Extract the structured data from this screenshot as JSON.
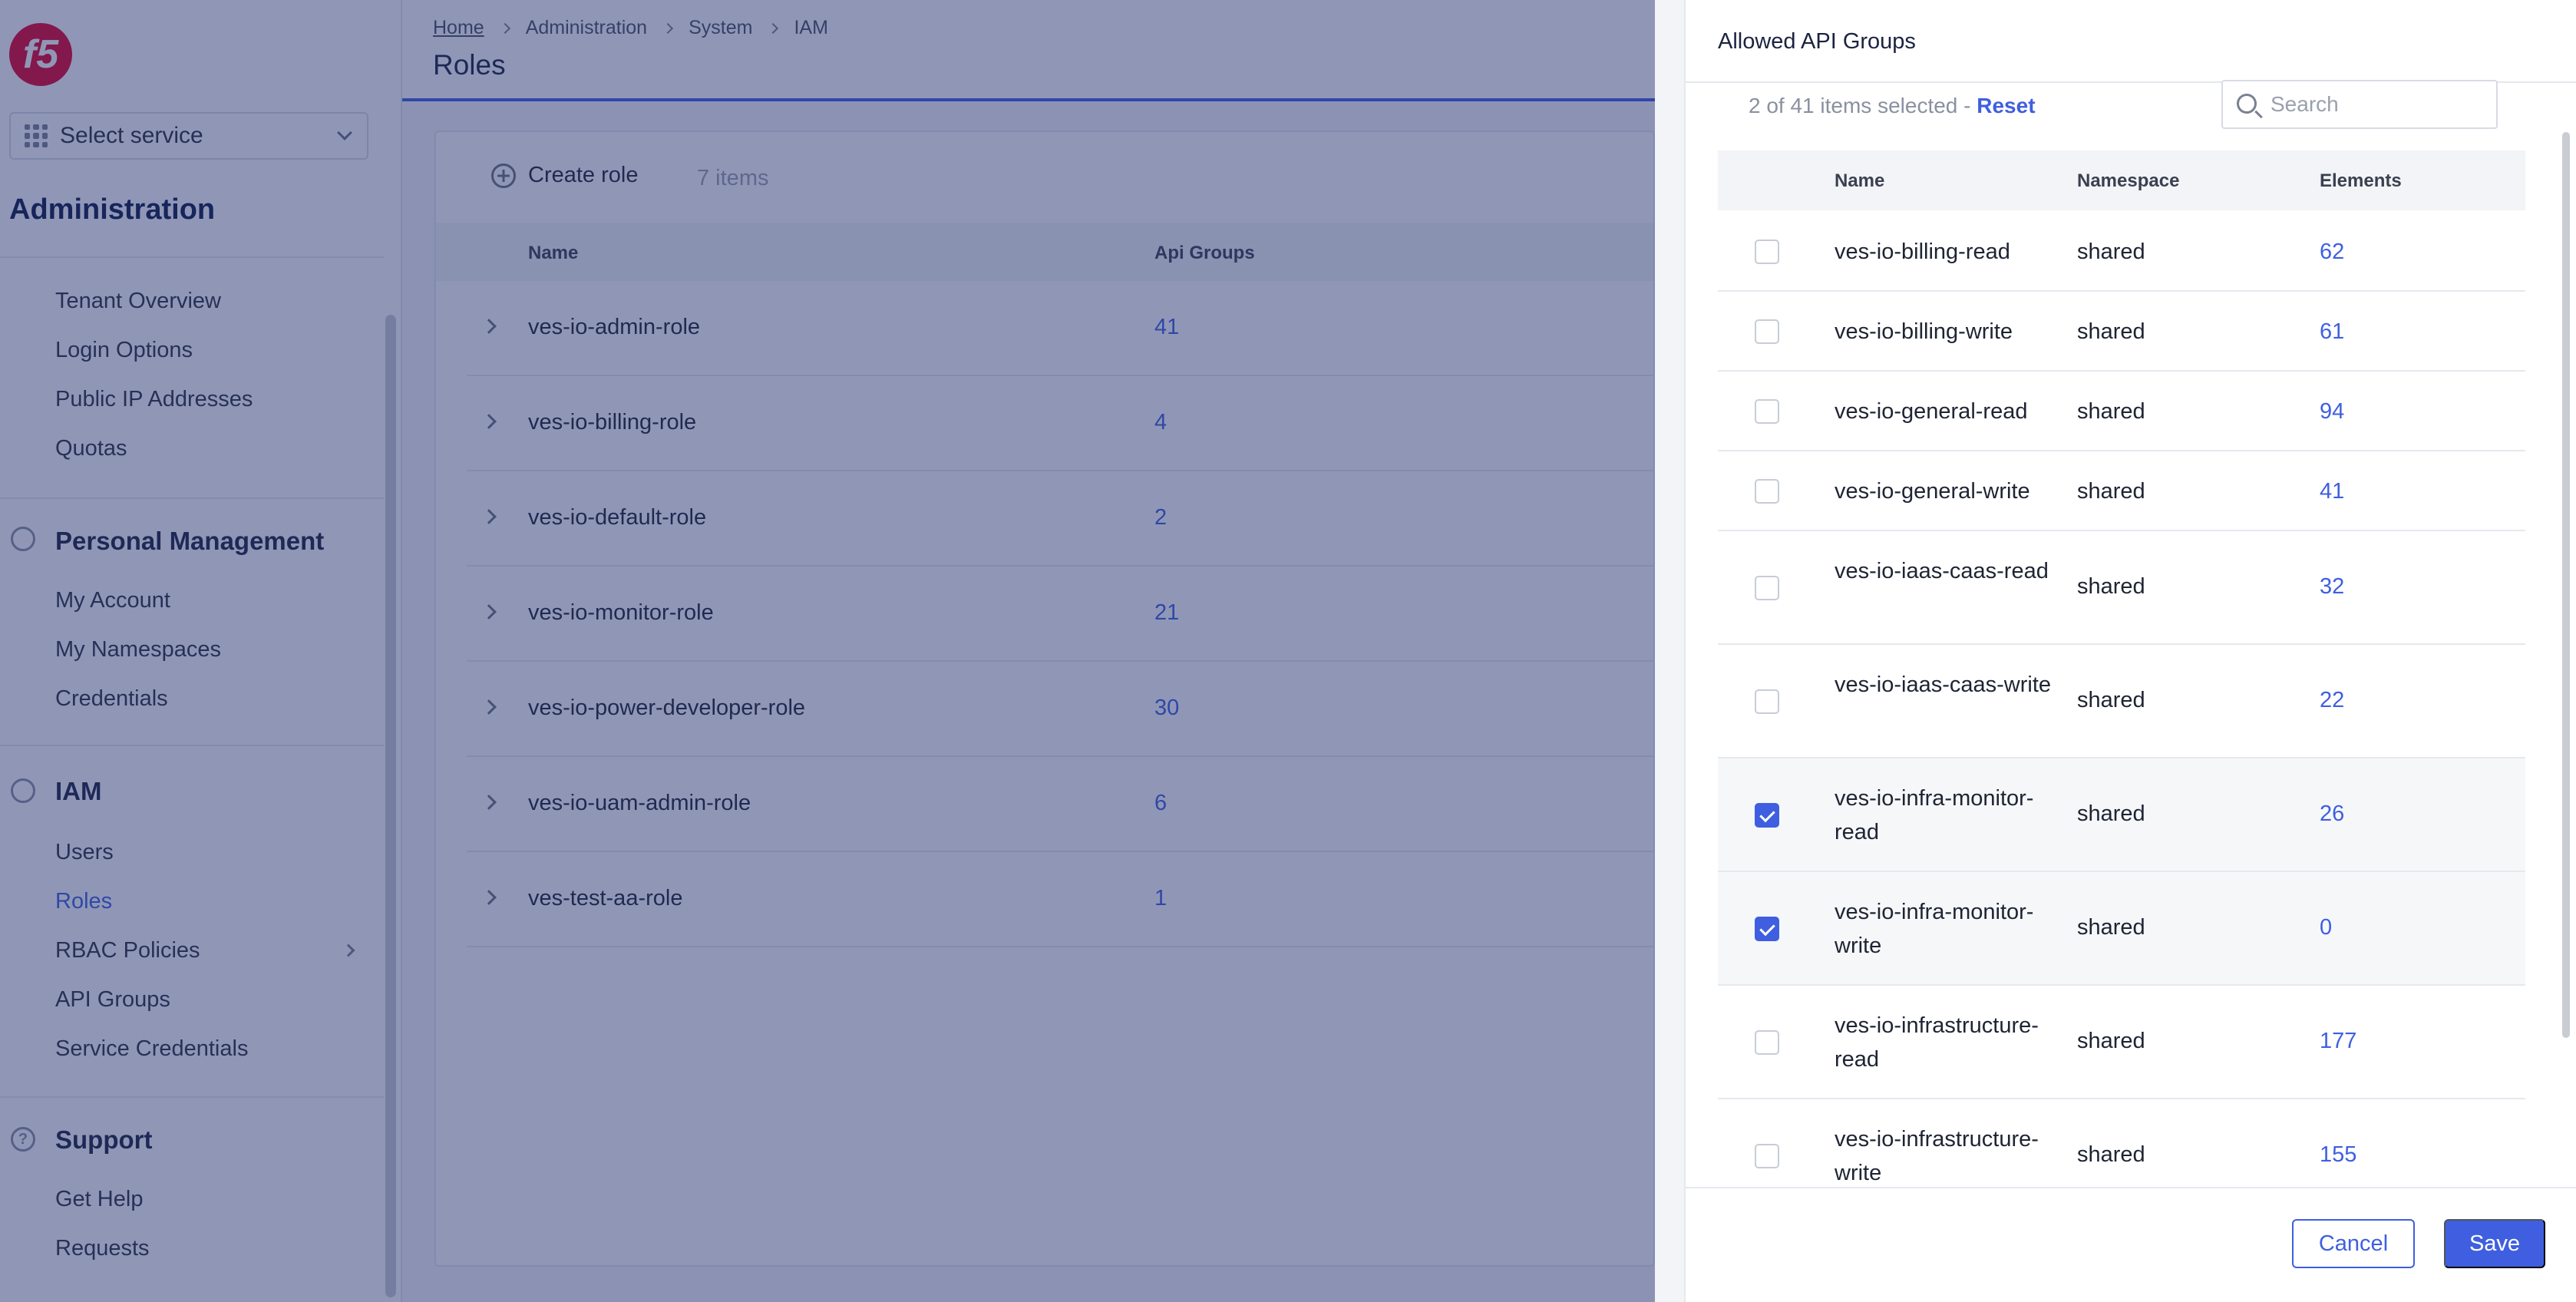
{
  "logo_text": "f5",
  "sidebar": {
    "service_select": "Select service",
    "heading": "Administration",
    "admin_items": [
      "Tenant Overview",
      "Login Options",
      "Public IP Addresses",
      "Quotas"
    ],
    "personal": {
      "title": "Personal Management",
      "items": [
        "My Account",
        "My Namespaces",
        "Credentials"
      ]
    },
    "iam": {
      "title": "IAM",
      "items": [
        "Users",
        "Roles",
        "RBAC Policies",
        "API Groups",
        "Service Credentials"
      ],
      "active": "Roles"
    },
    "support": {
      "title": "Support",
      "icon_glyph": "?",
      "items": [
        "Get Help",
        "Requests"
      ]
    }
  },
  "header": {
    "breadcrumbs": [
      "Home",
      "Administration",
      "System",
      "IAM"
    ],
    "title": "Roles"
  },
  "roles_list": {
    "create_label": "Create role",
    "count_label": "7 items",
    "columns": [
      "Name",
      "Api Groups"
    ],
    "rows": [
      {
        "name": "ves-io-admin-role",
        "api_groups": "41"
      },
      {
        "name": "ves-io-billing-role",
        "api_groups": "4"
      },
      {
        "name": "ves-io-default-role",
        "api_groups": "2"
      },
      {
        "name": "ves-io-monitor-role",
        "api_groups": "21"
      },
      {
        "name": "ves-io-power-developer-role",
        "api_groups": "30"
      },
      {
        "name": "ves-io-uam-admin-role",
        "api_groups": "6"
      },
      {
        "name": "ves-test-aa-role",
        "api_groups": "1"
      }
    ]
  },
  "drawer": {
    "title": "Allowed API Groups",
    "selection_text": "2 of 41 items selected - ",
    "reset_label": "Reset",
    "search_placeholder": "Search",
    "columns": [
      "Name",
      "Namespace",
      "Elements"
    ],
    "rows": [
      {
        "name": "ves-io-billing-read",
        "namespace": "shared",
        "elements": "62",
        "checked": false
      },
      {
        "name": "ves-io-billing-write",
        "namespace": "shared",
        "elements": "61",
        "checked": false
      },
      {
        "name": "ves-io-general-read",
        "namespace": "shared",
        "elements": "94",
        "checked": false
      },
      {
        "name": "ves-io-general-write",
        "namespace": "shared",
        "elements": "41",
        "checked": false
      },
      {
        "name": "ves-io-iaas-caas-read",
        "namespace": "shared",
        "elements": "32",
        "checked": false
      },
      {
        "name": "ves-io-iaas-caas-write",
        "namespace": "shared",
        "elements": "22",
        "checked": false
      },
      {
        "name": "ves-io-infra-monitor-read",
        "namespace": "shared",
        "elements": "26",
        "checked": true
      },
      {
        "name": "ves-io-infra-monitor-write",
        "namespace": "shared",
        "elements": "0",
        "checked": true
      },
      {
        "name": "ves-io-infrastructure-read",
        "namespace": "shared",
        "elements": "177",
        "checked": false
      },
      {
        "name": "ves-io-infrastructure-write",
        "namespace": "shared",
        "elements": "155",
        "checked": false
      }
    ],
    "cancel_label": "Cancel",
    "save_label": "Save"
  },
  "colors": {
    "accent": "#3f5fe0",
    "logo": "#e4002b",
    "overlay": "#22306e"
  }
}
